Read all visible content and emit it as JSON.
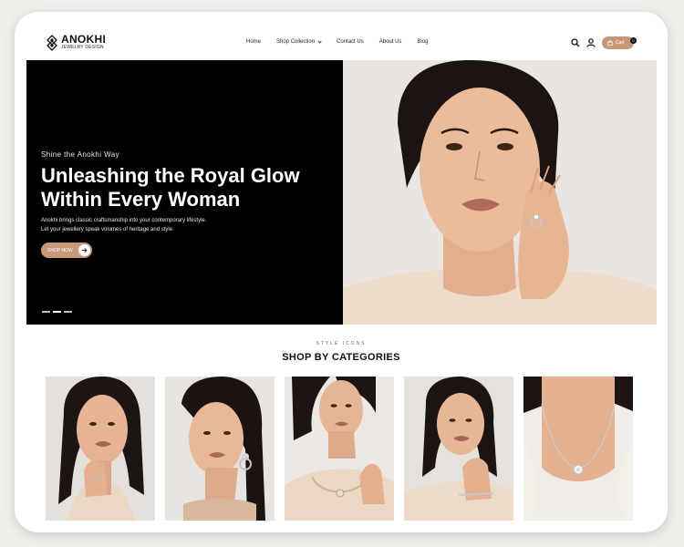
{
  "brand": {
    "name": "ANOKHI",
    "tagline": "JEWELRY DESIGN"
  },
  "nav": {
    "items": [
      {
        "label": "Home"
      },
      {
        "label": "Shop Collection",
        "has_dropdown": true
      },
      {
        "label": "Contact Us"
      },
      {
        "label": "About Us"
      },
      {
        "label": "Blog"
      }
    ]
  },
  "header": {
    "cart_label": "Cart",
    "cart_count": "0",
    "icons": [
      "search-icon",
      "user-icon",
      "bag-icon"
    ]
  },
  "hero": {
    "eyebrow": "Shine the Anokhi Way",
    "title": "Unleashing the Royal Glow Within Every Woman",
    "description_line1": "Anokhi brings classic craftsmanship into your contemporary lifestyle.",
    "description_line2": "Let your jewellery speak volumes of heritage and style.",
    "button_label": "SHOP NOW",
    "slides": 3,
    "active_slide": 2
  },
  "categories": {
    "eyebrow": "STYLE ICONS",
    "title": "SHOP BY CATEGORIES",
    "cards": [
      {
        "image": "woman-wearing-ring"
      },
      {
        "image": "woman-wearing-earring"
      },
      {
        "image": "woman-wearing-necklace-and-ring"
      },
      {
        "image": "woman-wearing-bracelet"
      },
      {
        "image": "pendant-necklace"
      }
    ]
  },
  "colors": {
    "accent": "#c69a78",
    "hero_bg": "#000000",
    "frame_bg": "#ffffff",
    "page_bg": "#f1efec"
  }
}
